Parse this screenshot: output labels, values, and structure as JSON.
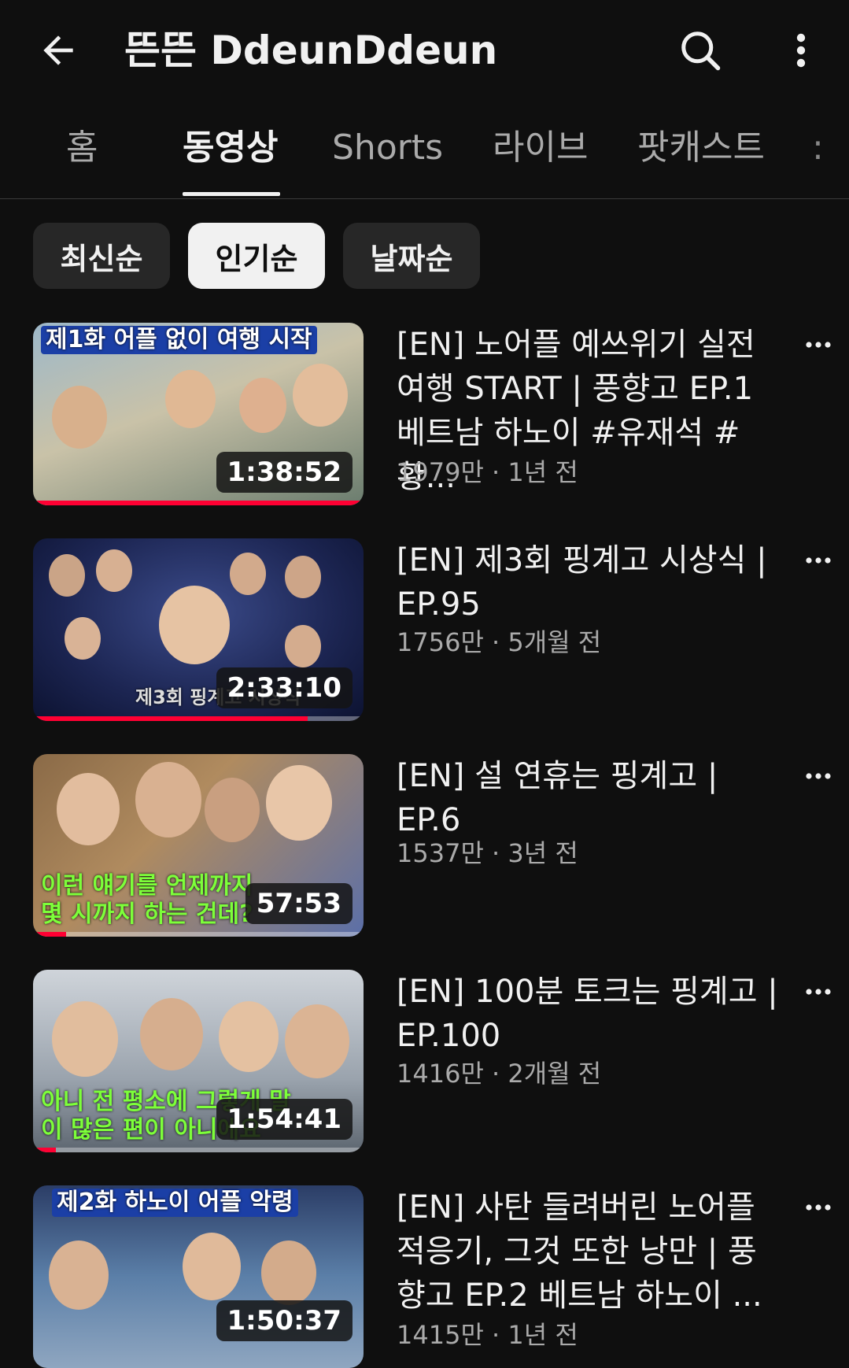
{
  "header": {
    "back_icon": "arrow-left-icon",
    "channel_title": "뜬뜬 DdeunDdeun",
    "search_icon": "search-icon",
    "more_icon": "more-vert-icon"
  },
  "tabs": [
    {
      "label": "홈"
    },
    {
      "label": "동영상",
      "active": true
    },
    {
      "label": "Shorts"
    },
    {
      "label": "라이브"
    },
    {
      "label": "팟캐스트"
    }
  ],
  "tab_overflow": ":",
  "chips": [
    {
      "label": "최신순"
    },
    {
      "label": "인기순",
      "active": true
    },
    {
      "label": "날짜순"
    }
  ],
  "videos": [
    {
      "title": "[EN] 노어플 예쓰위기 실전 여행 START | 풍향고 EP.1 베트남 하노이 #유재석 #황...",
      "meta": "1979만 · 1년 전",
      "duration": "1:38:52",
      "caption": "제1화 어플 없이 여행 시작",
      "progress": 1.0
    },
    {
      "title": "[EN] 제3회 핑계고 시상식 | EP.95",
      "meta": "1756만 · 5개월 전",
      "duration": "2:33:10",
      "caption": "제3회 핑계고 시상식",
      "progress": 0.83
    },
    {
      "title": "[EN] 설 연휴는 핑계고 | EP.6",
      "meta": "1537만 · 3년 전",
      "duration": "57:53",
      "caption": "이런 얘기를 언제까지 몇 시까지 하는 건데?",
      "progress": 0.1
    },
    {
      "title": "[EN] 100분 토크는 핑계고 | EP.100",
      "meta": "1416만 · 2개월 전",
      "duration": "1:54:41",
      "caption": "아니 전 평소에 그렇게 말이 많은 편이 아니에요",
      "progress": 0.07
    },
    {
      "title": "[EN] 사탄 들려버린 노어플 적응기, 그것 또한 낭만 | 풍향고 EP.2 베트남 하노이 ...",
      "meta": "1415만 · 1년 전",
      "duration": "1:50:37",
      "caption": "제2화 하노이 어플 악령",
      "progress": 0
    }
  ],
  "colors": {
    "background": "#0f0f0f",
    "text": "#f1f1f1",
    "secondary_text": "#aaaaaa",
    "chip": "#272727",
    "progress": "#ff0033"
  }
}
